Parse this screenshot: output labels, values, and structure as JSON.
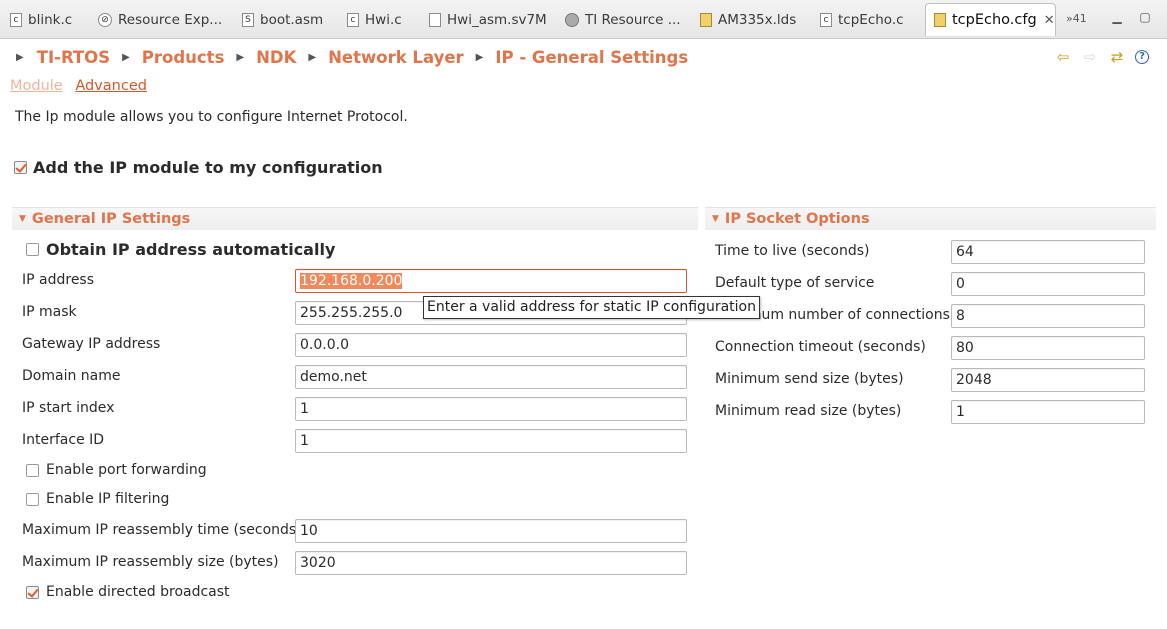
{
  "tabs": [
    {
      "label": "blink.c",
      "icon": "c-file-icon"
    },
    {
      "label": "Resource Exp...",
      "icon": "compass-icon"
    },
    {
      "label": "boot.asm",
      "icon": "asm-file-icon"
    },
    {
      "label": "Hwi.c",
      "icon": "c-file-icon"
    },
    {
      "label": "Hwi_asm.sv7M",
      "icon": "file-icon"
    },
    {
      "label": "TI Resource ...",
      "icon": "globe-icon"
    },
    {
      "label": "AM335x.lds",
      "icon": "linker-file-icon"
    },
    {
      "label": "tcpEcho.c",
      "icon": "c-file-icon"
    },
    {
      "label": "tcpEcho.cfg",
      "icon": "cfg-file-icon",
      "active": true
    }
  ],
  "tabs_overflow": "»41",
  "breadcrumb": [
    "TI-RTOS",
    "Products",
    "NDK",
    "Network Layer",
    "IP - General Settings"
  ],
  "subtabs": {
    "module": "Module",
    "advanced": "Advanced"
  },
  "description": "The Ip module allows you to configure Internet Protocol.",
  "add_module": {
    "label": "Add the IP module to my configuration",
    "checked": true
  },
  "general": {
    "title": "General IP Settings",
    "obtain_auto": {
      "label": "Obtain IP address automatically",
      "checked": false
    },
    "ip_address": {
      "label": "IP address",
      "value": "192.168.0.200"
    },
    "ip_mask": {
      "label": "IP mask",
      "value": "255.255.255.0"
    },
    "gateway": {
      "label": "Gateway IP address",
      "value": "0.0.0.0"
    },
    "domain": {
      "label": "Domain name",
      "value": "demo.net"
    },
    "start_index": {
      "label": "IP start index",
      "value": "1"
    },
    "interface_id": {
      "label": "Interface ID",
      "value": "1"
    },
    "port_forwarding": {
      "label": "Enable port forwarding",
      "checked": false
    },
    "ip_filtering": {
      "label": "Enable IP filtering",
      "checked": false
    },
    "reasm_time": {
      "label": "Maximum IP reassembly time (seconds)",
      "value": "10"
    },
    "reasm_size": {
      "label": "Maximum IP reassembly size (bytes)",
      "value": "3020"
    },
    "directed_broadcast": {
      "label": "Enable directed broadcast",
      "checked": true
    }
  },
  "socket": {
    "title": "IP Socket Options",
    "ttl": {
      "label": "Time to live (seconds)",
      "value": "64"
    },
    "tos": {
      "label": "Default type of service",
      "value": "0"
    },
    "max_conn": {
      "label": "Maximum number of connections",
      "value": "8"
    },
    "conn_timeout": {
      "label": "Connection timeout (seconds)",
      "value": "80"
    },
    "min_send": {
      "label": "Minimum send size (bytes)",
      "value": "2048"
    },
    "min_read": {
      "label": "Minimum read size (bytes)",
      "value": "1"
    }
  },
  "tooltip": "Enter a valid address for static IP configuration",
  "colors": {
    "accent": "#e0744a",
    "error_border": "#d9552a",
    "selection": "#f08a5d"
  }
}
